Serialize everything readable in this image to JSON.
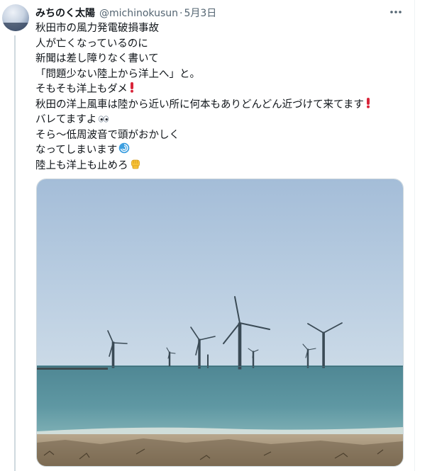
{
  "tweet": {
    "display_name": "みちのく太陽",
    "handle": "@michinokusun",
    "separator": "·",
    "date": "5月3日",
    "lines": [
      "秋田市の風力発電破損事故",
      "人が亡くなっているのに",
      "新聞は差し障りなく書いて",
      "「問題少ない陸上から洋上へ」と。",
      "そもそも洋上もダメ",
      "秋田の洋上風車は陸から近い所に何本もありどんどん近づけて来てます",
      "バレてますよ",
      "そら〜低周波音で頭がおかしく",
      "なってしまいます",
      "陸上も洋上も止めろ"
    ],
    "line_emojis": {
      "4": "exclamation-icon",
      "5": "exclamation-icon",
      "6": "eyes-icon",
      "8": "cyclone-icon",
      "9": "fist-icon"
    },
    "media_alt": "wind-turbines-at-sea-photo"
  },
  "colors": {
    "text": "#0f1419",
    "secondary": "#536471",
    "border": "#cfd9de",
    "exclamation": "#d9253a",
    "cyclone": "#3d9fe0",
    "fist": "#f7c23a"
  }
}
